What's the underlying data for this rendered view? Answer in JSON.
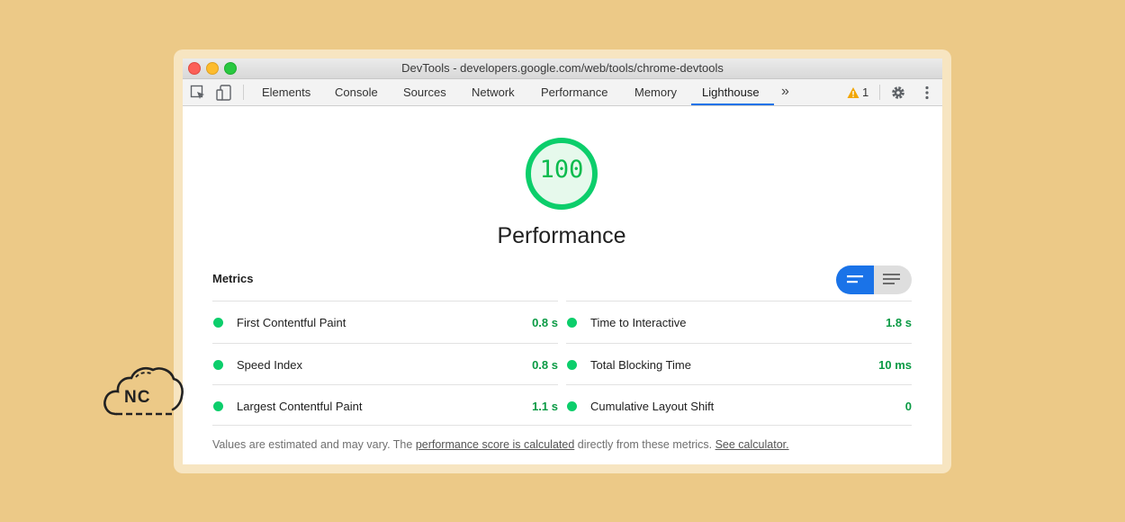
{
  "window": {
    "title": "DevTools - developers.google.com/web/tools/chrome-devtools"
  },
  "toolbar": {
    "tabs": [
      {
        "label": "Elements"
      },
      {
        "label": "Console"
      },
      {
        "label": "Sources"
      },
      {
        "label": "Network"
      },
      {
        "label": "Performance"
      },
      {
        "label": "Memory"
      },
      {
        "label": "Lighthouse",
        "active": true
      }
    ],
    "more_label": "»",
    "warning_count": "1",
    "icons": [
      "inspect-element-icon",
      "device-toggle-icon",
      "warning-icon",
      "gear-icon",
      "kebab-menu-icon"
    ]
  },
  "report": {
    "score": "100",
    "category_title": "Performance",
    "metrics_title": "Metrics",
    "metrics_left": [
      {
        "name": "First Contentful Paint",
        "value": "0.8 s"
      },
      {
        "name": "Speed Index",
        "value": "0.8 s"
      },
      {
        "name": "Largest Contentful Paint",
        "value": "1.1 s"
      }
    ],
    "metrics_right": [
      {
        "name": "Time to Interactive",
        "value": "1.8 s"
      },
      {
        "name": "Total Blocking Time",
        "value": "10 ms"
      },
      {
        "name": "Cumulative Layout Shift",
        "value": "0"
      }
    ],
    "footer_text_1": "Values are estimated and may vary. The ",
    "footer_link_1": "performance score is calculated",
    "footer_text_2": " directly from these metrics. ",
    "footer_link_2": "See calculator."
  },
  "logo": {
    "text": "NC"
  },
  "colors": {
    "background": "#ecc987",
    "pass_green": "#0cce6b",
    "accent_blue": "#1a73e8"
  }
}
